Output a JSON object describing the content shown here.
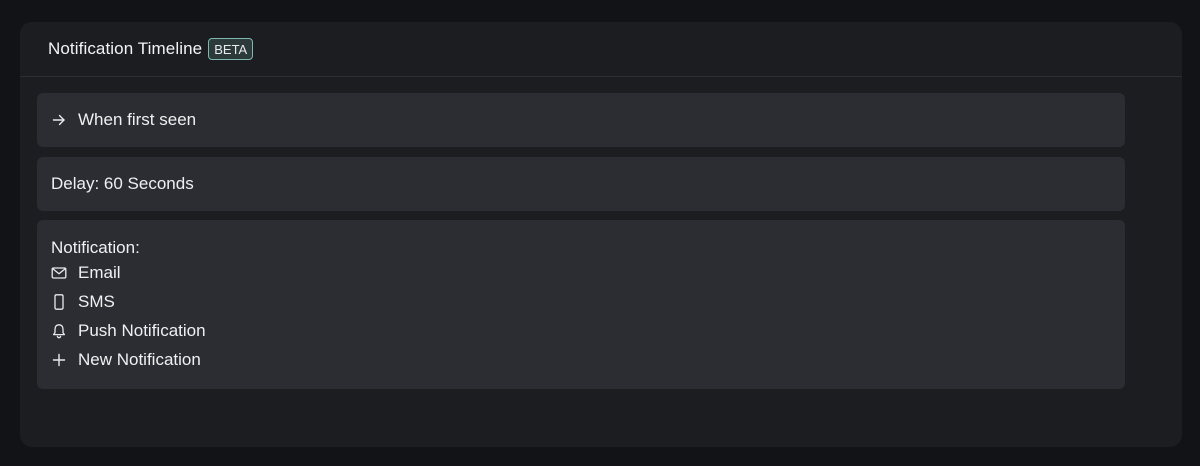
{
  "header": {
    "title": "Notification Timeline",
    "badge": "BETA"
  },
  "trigger": {
    "icon": "arrow-right-icon",
    "label": "When first seen"
  },
  "delay": {
    "label": "Delay: 60 Seconds"
  },
  "notification": {
    "heading": "Notification:",
    "channels": [
      {
        "icon": "envelope-icon",
        "label": "Email"
      },
      {
        "icon": "mobile-phone-icon",
        "label": "SMS"
      },
      {
        "icon": "bell-icon",
        "label": "Push Notification"
      }
    ],
    "add": {
      "icon": "plus-icon",
      "label": "New Notification"
    }
  },
  "colors": {
    "page_background": "#121317",
    "card_background": "#1c1d21",
    "step_background": "#2b2d32",
    "badge_border": "#7fb8b0"
  }
}
